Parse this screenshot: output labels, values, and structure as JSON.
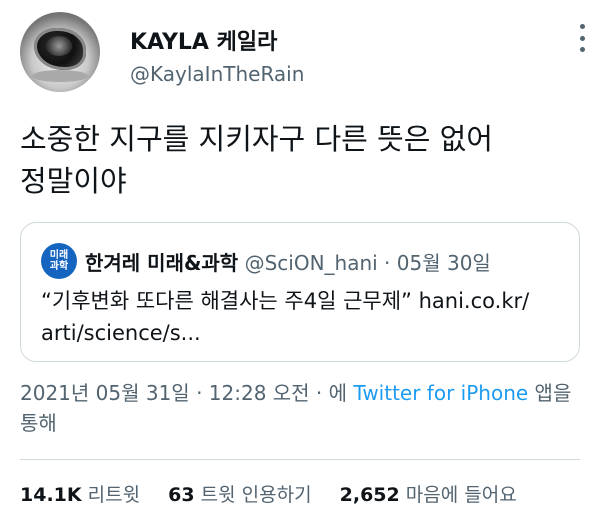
{
  "author": {
    "display_name": "KAYLA 케일라",
    "handle": "@KaylaInTheRain"
  },
  "tweet": {
    "text": "소중한 지구를 지키자구 다른 뜻은 없어\n정말이야"
  },
  "quote": {
    "avatar_text": "미래\n과학",
    "display_name": "한겨레 미래&과학",
    "handle": "@SciON_hani",
    "separator": " · ",
    "date": "05월 30일",
    "text": "“기후변화 또다른 해결사는 주4일 근무제” hani.co.kr/\narti/science/s..."
  },
  "timestamp": {
    "time": "2021년 05월 31일 · 12:28 오전 · 에 ",
    "source": "Twitter for iPhone",
    "suffix": " 앱을 통해"
  },
  "stats": {
    "retweets_count": "14.1K",
    "retweets_label": "리트윗",
    "quotes_count": "63",
    "quotes_label": "트윗 인용하기",
    "likes_count": "2,652",
    "likes_label": "마음에 들어요"
  },
  "icons": {
    "more": "more-vertical-icon"
  }
}
